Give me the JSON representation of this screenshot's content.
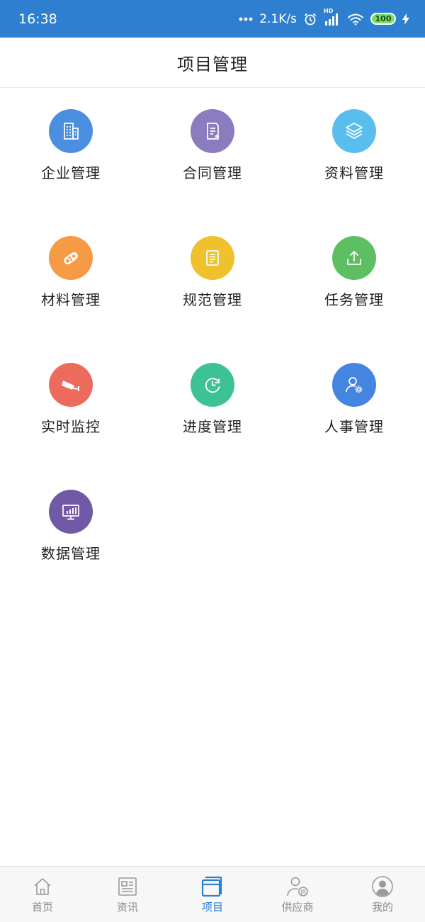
{
  "status": {
    "time": "16:38",
    "net_speed": "2.1K/s",
    "network_badge": "HD",
    "battery": "100"
  },
  "header": {
    "title": "项目管理"
  },
  "menu": [
    {
      "label": "企业管理",
      "icon": "building-icon",
      "color": "#4b8fe0"
    },
    {
      "label": "合同管理",
      "icon": "contract-icon",
      "color": "#8b7bbf"
    },
    {
      "label": "资料管理",
      "icon": "layers-icon",
      "color": "#59bdee"
    },
    {
      "label": "材料管理",
      "icon": "materials-icon",
      "color": "#f59a45"
    },
    {
      "label": "规范管理",
      "icon": "standards-book-icon",
      "color": "#eec12d"
    },
    {
      "label": "任务管理",
      "icon": "upload-tray-icon",
      "color": "#5dbf62"
    },
    {
      "label": "实时监控",
      "icon": "cctv-camera-icon",
      "color": "#ec6b5c"
    },
    {
      "label": "进度管理",
      "icon": "progress-clock-icon",
      "color": "#3dc296"
    },
    {
      "label": "人事管理",
      "icon": "user-settings-icon",
      "color": "#4585e2"
    },
    {
      "label": "数据管理",
      "icon": "monitor-chart-icon",
      "color": "#7159a6"
    }
  ],
  "tabbar": {
    "active_color": "#2f7fd0",
    "items": [
      {
        "label": "首页",
        "icon": "home-icon"
      },
      {
        "label": "资讯",
        "icon": "news-icon"
      },
      {
        "label": "项目",
        "icon": "project-icon",
        "active": true
      },
      {
        "label": "供应商",
        "icon": "supplier-icon"
      },
      {
        "label": "我的",
        "icon": "profile-icon"
      }
    ]
  }
}
